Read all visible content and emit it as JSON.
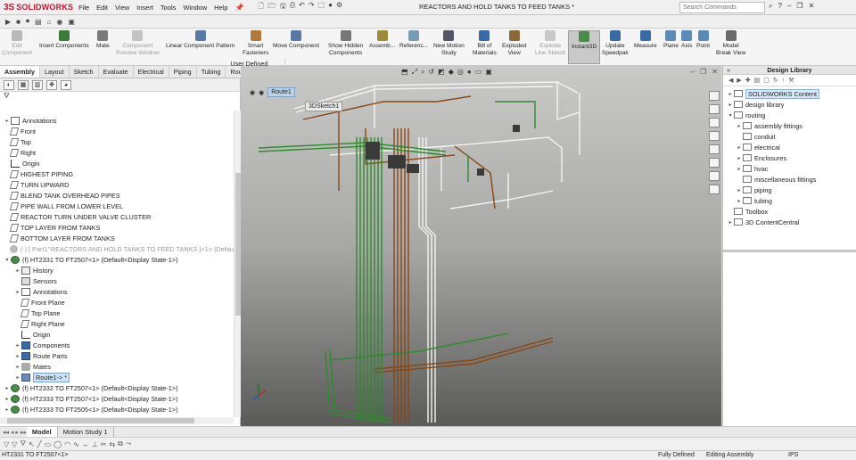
{
  "app": {
    "brand_ds": "3S",
    "brand_name": "SOLIDWORKS",
    "doc_title": "REACTORS AND HOLD TANKS TO FEED TANKS *"
  },
  "menu": [
    "File",
    "Edit",
    "View",
    "Insert",
    "Tools",
    "Window",
    "Help"
  ],
  "search": {
    "placeholder": "Search Commands"
  },
  "commands": [
    {
      "id": "edit-component",
      "label": "Edit\nComponent",
      "disabled": true
    },
    {
      "id": "insert-components",
      "label": "Insert Components",
      "disabled": false
    },
    {
      "id": "mate",
      "label": "Mate",
      "disabled": false
    },
    {
      "id": "component-preview",
      "label": "Component\nPreview Window",
      "disabled": true
    },
    {
      "id": "linear-pattern",
      "label": "Linear Component Pattern",
      "disabled": false
    },
    {
      "id": "smart-fasteners",
      "label": "Smart\nFasteners",
      "disabled": false
    },
    {
      "id": "move-component",
      "label": "Move Component",
      "disabled": false
    },
    {
      "id": "show-hidden",
      "label": "Show Hidden\nComponents",
      "disabled": false
    },
    {
      "id": "assembly-features",
      "label": "Assemb...",
      "disabled": false
    },
    {
      "id": "reference-geometry",
      "label": "Referenc...",
      "disabled": false
    },
    {
      "id": "new-motion-study",
      "label": "New Motion\nStudy",
      "disabled": false
    },
    {
      "id": "bill-of-materials",
      "label": "Bill of\nMaterials",
      "disabled": false
    },
    {
      "id": "exploded-view",
      "label": "Exploded\nView",
      "disabled": false
    },
    {
      "id": "explode-line-sketch",
      "label": "Explode\nLine Sketch",
      "disabled": true
    },
    {
      "id": "instant3d",
      "label": "Instant3D",
      "disabled": false,
      "active": true
    },
    {
      "id": "update-speedpak",
      "label": "Update\nSpeedpak",
      "disabled": false
    },
    {
      "id": "measure",
      "label": "Measure",
      "disabled": false
    },
    {
      "id": "plane",
      "label": "Plane",
      "disabled": false
    },
    {
      "id": "axis",
      "label": "Axis",
      "disabled": false
    },
    {
      "id": "point",
      "label": "Point",
      "disabled": false
    },
    {
      "id": "model-break-view",
      "label": "Model\nBreak View",
      "disabled": false
    }
  ],
  "tabs": [
    "Assembly",
    "Layout",
    "Sketch",
    "Evaluate",
    "Electrical",
    "Piping",
    "Tubing",
    "User Defined Route"
  ],
  "tree": [
    {
      "label": "Annotations",
      "indent": 0,
      "tw": "▸",
      "icon": "annotation"
    },
    {
      "label": "Front",
      "indent": 0,
      "tw": "",
      "icon": "plane"
    },
    {
      "label": "Top",
      "indent": 0,
      "tw": "",
      "icon": "plane"
    },
    {
      "label": "Right",
      "indent": 0,
      "tw": "",
      "icon": "plane"
    },
    {
      "label": "Origin",
      "indent": 0,
      "tw": "",
      "icon": "origin"
    },
    {
      "label": "HIGHEST PIPING",
      "indent": 0,
      "tw": "",
      "icon": "plane"
    },
    {
      "label": "TURN UPWARD",
      "indent": 0,
      "tw": "",
      "icon": "plane"
    },
    {
      "label": "BLEND TANK OVERHEAD PIPES",
      "indent": 0,
      "tw": "",
      "icon": "plane"
    },
    {
      "label": "PIPE WALL FROM LOWER LEVEL",
      "indent": 0,
      "tw": "",
      "icon": "plane"
    },
    {
      "label": "REACTOR TURN UNDER VALVE CLUSTER",
      "indent": 0,
      "tw": "",
      "icon": "plane"
    },
    {
      "label": "TOP LAYER FROM TANKS",
      "indent": 0,
      "tw": "",
      "icon": "plane"
    },
    {
      "label": "BOTTOM LAYER FROM TANKS",
      "indent": 0,
      "tw": "",
      "icon": "plane"
    },
    {
      "label": "(-) [ Part1^REACTORS AND HOLD TANKS TO FEED TANKS ]<1> (Defau",
      "indent": 0,
      "tw": "",
      "icon": "part",
      "grey": true
    },
    {
      "label": "(f) HT2331 TO FT2507<1> (Default<Display State-1>)",
      "indent": 0,
      "tw": "▾",
      "icon": "assembly"
    },
    {
      "label": "History",
      "indent": 1,
      "tw": "▸",
      "icon": "history"
    },
    {
      "label": "Sensors",
      "indent": 1,
      "tw": "",
      "icon": "sensor"
    },
    {
      "label": "Annotations",
      "indent": 1,
      "tw": "▸",
      "icon": "annotation"
    },
    {
      "label": "Front Plane",
      "indent": 1,
      "tw": "",
      "icon": "plane"
    },
    {
      "label": "Top Plane",
      "indent": 1,
      "tw": "",
      "icon": "plane"
    },
    {
      "label": "Right Plane",
      "indent": 1,
      "tw": "",
      "icon": "plane"
    },
    {
      "label": "Origin",
      "indent": 1,
      "tw": "",
      "icon": "origin"
    },
    {
      "label": "Components",
      "indent": 1,
      "tw": "▸",
      "icon": "folder"
    },
    {
      "label": "Route Parts",
      "indent": 1,
      "tw": "▸",
      "icon": "folder"
    },
    {
      "label": "Mates",
      "indent": 1,
      "tw": "▸",
      "icon": "mates"
    },
    {
      "label": "Route1-> *",
      "indent": 1,
      "tw": "▸",
      "icon": "route",
      "selected": true
    },
    {
      "label": "(f) HT2332 TO FT2507<1> (Default<Display State-1>)",
      "indent": 0,
      "tw": "▸",
      "icon": "assembly"
    },
    {
      "label": "(f) HT2333 TO FT2507<1> (Default<Display State-1>)",
      "indent": 0,
      "tw": "▸",
      "icon": "assembly"
    },
    {
      "label": "(f) HT2333 TO FT2505<1> (Default<Display State-1>)",
      "indent": 0,
      "tw": "▸",
      "icon": "assembly"
    }
  ],
  "breadcrumb": {
    "route": "Route1",
    "sketch": "3DSketch1"
  },
  "design_library": {
    "title": "Design Library",
    "items": [
      {
        "label": "SOLIDWORKS Content",
        "indent": 0,
        "tw": "▸",
        "selected": true
      },
      {
        "label": "design library",
        "indent": 0,
        "tw": "▸"
      },
      {
        "label": "routing",
        "indent": 0,
        "tw": "▾"
      },
      {
        "label": "assembly fittings",
        "indent": 1,
        "tw": "▸"
      },
      {
        "label": "conduit",
        "indent": 1,
        "tw": ""
      },
      {
        "label": "electrical",
        "indent": 1,
        "tw": "▸"
      },
      {
        "label": "Enclosures",
        "indent": 1,
        "tw": "▸"
      },
      {
        "label": "hvac",
        "indent": 1,
        "tw": "▸"
      },
      {
        "label": "miscellaneous fittings",
        "indent": 1,
        "tw": ""
      },
      {
        "label": "piping",
        "indent": 1,
        "tw": "▸"
      },
      {
        "label": "tubing",
        "indent": 1,
        "tw": "▸"
      },
      {
        "label": "Toolbox",
        "indent": 0,
        "tw": ""
      },
      {
        "label": "3D ContentCentral",
        "indent": 0,
        "tw": "▸"
      }
    ]
  },
  "model_tabs": [
    "Model",
    "Motion Study 1"
  ],
  "status": {
    "left": "HT2331 TO FT2507<1>",
    "defined": "Fully Defined",
    "mode": "Editing Assembly",
    "units": "IPS"
  },
  "colors": {
    "accent": "#c8102e",
    "pipe_green": "#2e8b2e",
    "pipe_brown": "#8b4513",
    "pipe_white": "#f2f2f2"
  }
}
